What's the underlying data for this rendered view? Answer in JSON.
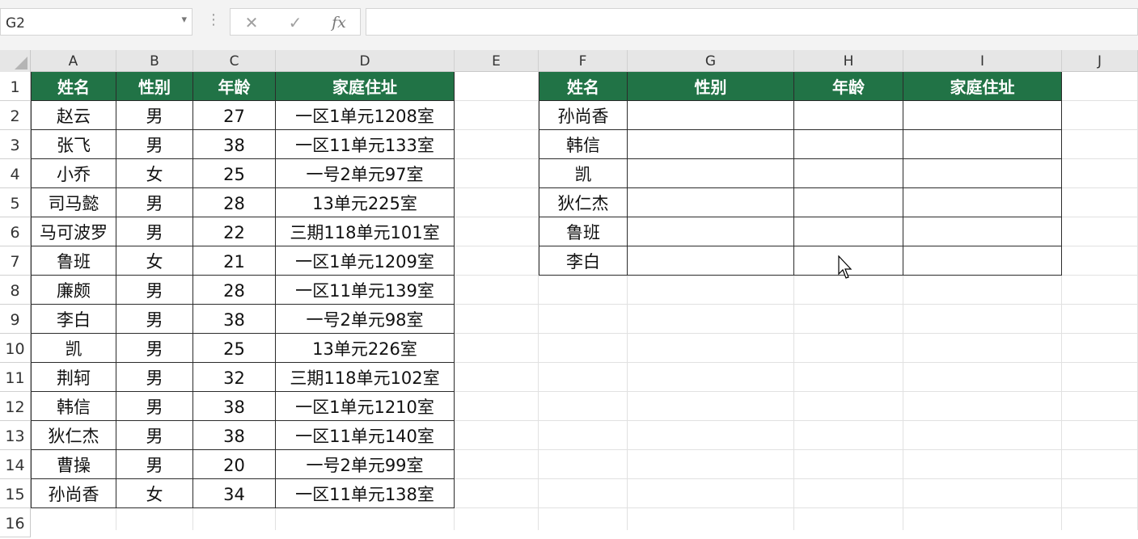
{
  "formula_bar": {
    "name_box": "G2",
    "name_box_arrow": "▾",
    "dots": "⋮",
    "cancel_symbol": "✕",
    "enter_symbol": "✓",
    "fx_label": "fx",
    "formula": ""
  },
  "columns": [
    "A",
    "B",
    "C",
    "D",
    "E",
    "F",
    "G",
    "H",
    "I",
    "J"
  ],
  "rows": [
    "1",
    "2",
    "3",
    "4",
    "5",
    "6",
    "7",
    "8",
    "9",
    "10",
    "11",
    "12",
    "13",
    "14",
    "15",
    "16"
  ],
  "left_table": {
    "headers": [
      "姓名",
      "性别",
      "年龄",
      "家庭住址"
    ],
    "rows": [
      [
        "赵云",
        "男",
        "27",
        "一区1单元1208室"
      ],
      [
        "张飞",
        "男",
        "38",
        "一区11单元133室"
      ],
      [
        "小乔",
        "女",
        "25",
        "一号2单元97室"
      ],
      [
        "司马懿",
        "男",
        "28",
        "13单元225室"
      ],
      [
        "马可波罗",
        "男",
        "22",
        "三期118单元101室"
      ],
      [
        "鲁班",
        "女",
        "21",
        "一区1单元1209室"
      ],
      [
        "廉颇",
        "男",
        "28",
        "一区11单元139室"
      ],
      [
        "李白",
        "男",
        "38",
        "一号2单元98室"
      ],
      [
        "凯",
        "男",
        "25",
        "13单元226室"
      ],
      [
        "荆轲",
        "男",
        "32",
        "三期118单元102室"
      ],
      [
        "韩信",
        "男",
        "38",
        "一区1单元1210室"
      ],
      [
        "狄仁杰",
        "男",
        "38",
        "一区11单元140室"
      ],
      [
        "曹操",
        "男",
        "20",
        "一号2单元99室"
      ],
      [
        "孙尚香",
        "女",
        "34",
        "一区11单元138室"
      ]
    ]
  },
  "right_table": {
    "headers": [
      "姓名",
      "性别",
      "年龄",
      "家庭住址"
    ],
    "names": [
      "孙尚香",
      "韩信",
      "凯",
      "狄仁杰",
      "鲁班",
      "李白"
    ]
  },
  "colors": {
    "header_fill": "#217346",
    "header_text": "#ffffff",
    "gridline": "#e1e1e1"
  },
  "cursor_icon": "mouse-pointer-icon"
}
